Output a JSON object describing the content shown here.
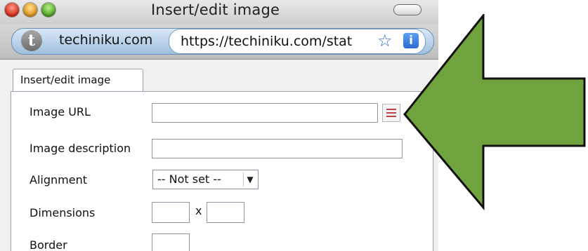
{
  "window": {
    "title": "Insert/edit image"
  },
  "browser": {
    "site_badge": "t",
    "site_name": "techiniku.com",
    "url": "https://techiniku.com/stat",
    "bookmark_icon": "star-icon",
    "info_icon": "info-icon",
    "info_glyph": "i"
  },
  "dialog": {
    "tab_label": "Insert/edit image",
    "fields": {
      "image_url_label": "Image URL",
      "image_url_value": "",
      "description_label": "Image description",
      "description_value": "",
      "alignment_label": "Alignment",
      "alignment_value": "-- Not set --",
      "dimensions_label": "Dimensions",
      "dimensions_separator": "x",
      "width_value": "",
      "height_value": "",
      "border_label": "Border",
      "border_value": ""
    },
    "browse_icon": "browse-list-icon"
  },
  "colors": {
    "arrow_fill": "#70a23e",
    "arrow_stroke": "#111111",
    "address_accent": "#9fbfdf"
  }
}
